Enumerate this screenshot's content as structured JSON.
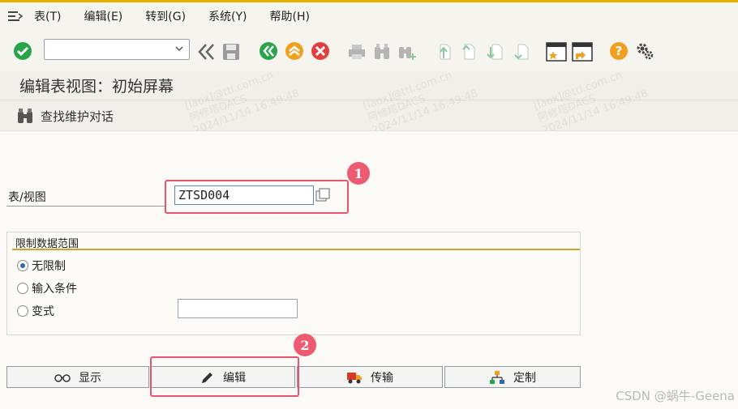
{
  "menu": {
    "items": [
      "表(T)",
      "编辑(E)",
      "转到(G)",
      "系统(Y)",
      "帮助(H)"
    ]
  },
  "toolbar": {
    "command_value": "",
    "icons": [
      "check-icon",
      "command-dropdown-icon",
      "double-left-icon",
      "save-icon",
      "back-icon",
      "exit-icon",
      "cancel-icon",
      "print-icon",
      "find-icon",
      "find-next-icon",
      "first-page-icon",
      "prev-page-icon",
      "next-page-icon",
      "last-page-icon",
      "new-session-icon",
      "shortcut-icon",
      "help-icon",
      "settings-icon"
    ],
    "colors": {
      "accent": "#e7b400",
      "check": "#2aa44a",
      "back": "#2aa44a",
      "exit": "#f0a020",
      "cancel": "#e04040",
      "help": "#f0a020"
    }
  },
  "title": "编辑表视图：初始屏幕",
  "app_toolbar": {
    "find_label": "查找维护对话"
  },
  "form": {
    "table_label": "表/视图",
    "table_value": "ZTSD004"
  },
  "restrict_group": {
    "title": "限制数据范围",
    "options": [
      {
        "label": "无限制",
        "selected": true
      },
      {
        "label": "输入条件",
        "selected": false
      },
      {
        "label": "变式",
        "selected": false
      }
    ],
    "variant_value": ""
  },
  "buttons": {
    "display": "显示",
    "edit": "编辑",
    "transport": "传输",
    "customize": "定制"
  },
  "annotations": {
    "badge1": "1",
    "badge2": "2"
  },
  "watermark": {
    "line1": "[laox]@ttl.com.cn",
    "line2": "阿修塔DACS",
    "line3": "2024/11/14 16:49:48"
  },
  "credit": "CSDN @蜗牛-Geena"
}
